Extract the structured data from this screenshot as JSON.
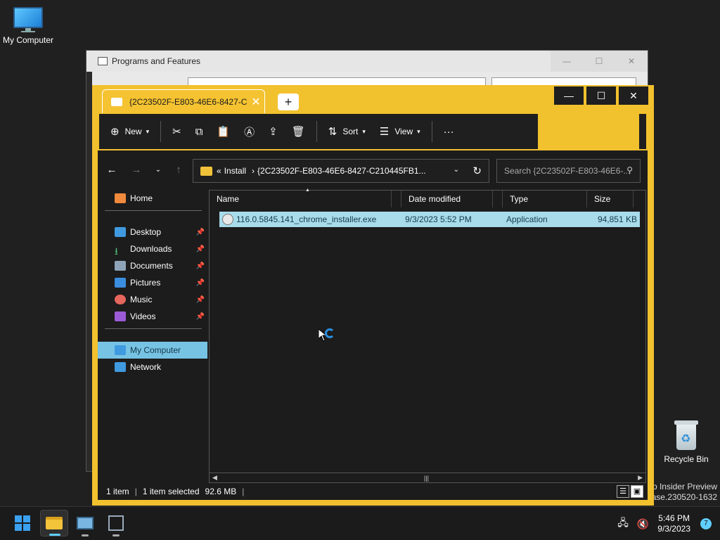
{
  "desktop": {
    "my_computer_label": "My Computer",
    "recycle_bin_label": "Recycle Bin",
    "watermark_line1": "o Insider Preview",
    "watermark_line2": "ease.230520-1632"
  },
  "background_window": {
    "title": "Programs and Features",
    "controls": [
      "—",
      "☐",
      "✕"
    ]
  },
  "explorer": {
    "tab_title": "{2C23502F-E803-46E6-8427-C",
    "tab_close": "✕",
    "new_tab": "+",
    "window_controls": {
      "minimize": "—",
      "maximize": "☐",
      "close": "✕"
    },
    "toolbar": {
      "new_label": "New",
      "sort_label": "Sort",
      "view_label": "View",
      "more_label": "···"
    },
    "address": {
      "overflow": "«",
      "crumb1": "Install",
      "crumb_sep": "›",
      "crumb2": "{2C23502F-E803-46E6-8427-C210445FB1...",
      "search_placeholder": "Search {2C23502F-E803-46E6-..."
    },
    "nav": {
      "home": "Home",
      "desktop": "Desktop",
      "downloads": "Downloads",
      "documents": "Documents",
      "pictures": "Pictures",
      "music": "Music",
      "videos": "Videos",
      "my_computer": "My Computer",
      "network": "Network"
    },
    "columns": {
      "name": "Name",
      "date": "Date modified",
      "type": "Type",
      "size": "Size"
    },
    "files": [
      {
        "name": "116.0.5845.141_chrome_installer.exe",
        "date": "9/3/2023 5:52 PM",
        "type": "Application",
        "size": "94,851 KB"
      }
    ],
    "status": {
      "items": "1 item",
      "selected": "1 item selected",
      "size": "92.6 MB"
    }
  },
  "taskbar": {
    "time": "5:46 PM",
    "date": "9/3/2023",
    "notification_count": "7"
  },
  "colors": {
    "accent": "#f2c12e",
    "selection": "#a8dceb",
    "nav_selected": "#77c3e3"
  }
}
